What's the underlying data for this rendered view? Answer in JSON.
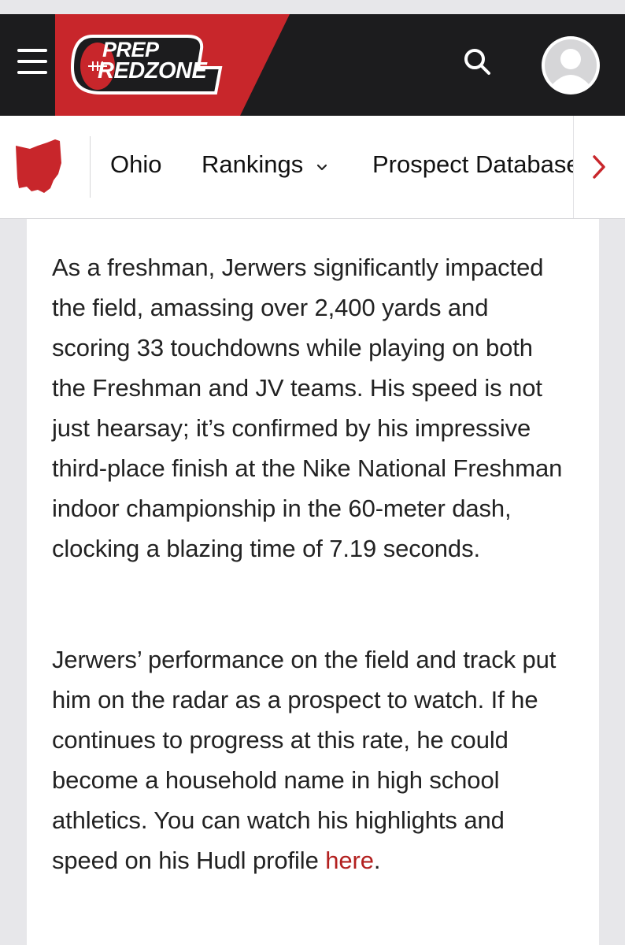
{
  "header": {
    "logo_line1": "PREP",
    "logo_line2": "REDZONE",
    "brand_red": "#c8262b",
    "bar_color": "#1c1c1e",
    "icons": [
      "hamburger-menu-icon",
      "search-icon",
      "user-avatar-icon"
    ]
  },
  "subnav": {
    "state_icon": "ohio-state-icon",
    "items": [
      {
        "label": "Ohio"
      },
      {
        "label": "Rankings",
        "has_dropdown": true
      },
      {
        "label": "Prospect Database"
      }
    ],
    "scroll_icon": "chevron-right-icon"
  },
  "article": {
    "paragraph1": "As a freshman, Jerwers significantly impacted the field, amassing over 2,400 yards and scoring 33 touchdowns while playing on both the Freshman and JV teams. His speed is not just hearsay; it’s confirmed by his impressive third-place finish at the Nike National Freshman indoor championship in the 60-meter dash, clocking a blazing time of 7.19 seconds.",
    "paragraph2": "Jerwers’ performance on the field and track put him on the radar as a prospect to watch. If he continues to progress at this rate, he could become a household name in high school athletics. You can watch his highlights and speed on his Hudl profile",
    "link_text": "here",
    "after_link": ".",
    "link_color": "#b3201f"
  }
}
